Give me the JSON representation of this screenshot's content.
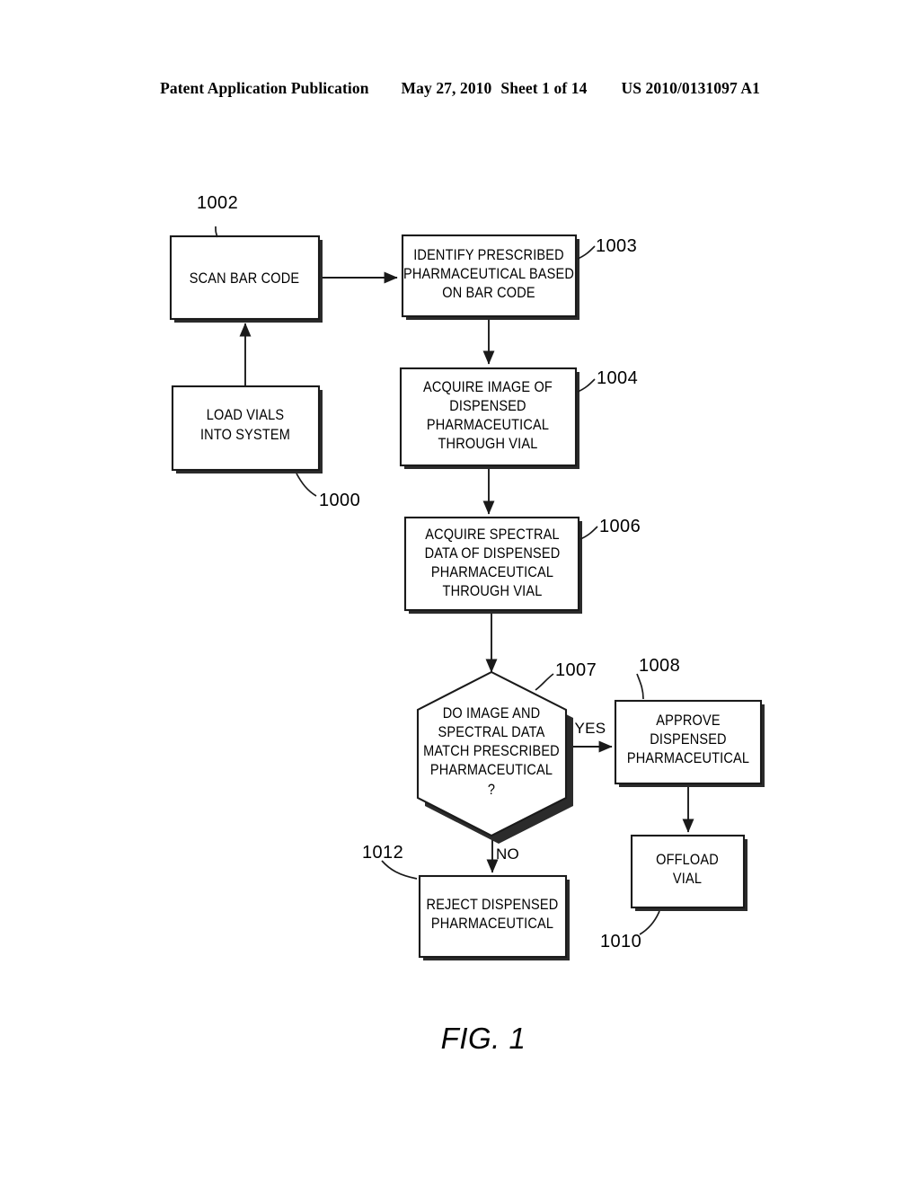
{
  "header": {
    "publication": "Patent Application Publication",
    "date": "May 27, 2010",
    "sheet": "Sheet 1 of 14",
    "patent_number": "US 2010/0131097 A1"
  },
  "figure": {
    "caption": "FIG. 1",
    "caption_label": "FIG.",
    "caption_number": "1"
  },
  "diagram_data": {
    "type": "flowchart",
    "title": "FIG. 1",
    "overall_reference": "1000",
    "nodes": [
      {
        "id": "scan_bar_code",
        "ref": "1002",
        "shape": "rect",
        "lines": [
          "SCAN BAR CODE"
        ],
        "text": "SCAN BAR CODE"
      },
      {
        "id": "identify_prescribed",
        "ref": "1003",
        "shape": "rect",
        "lines": [
          "IDENTIFY PRESCRIBED",
          "PHARMACEUTICAL BASED",
          "ON BAR CODE"
        ],
        "text": "IDENTIFY PRESCRIBED PHARMACEUTICAL BASED ON BAR CODE"
      },
      {
        "id": "load_vials",
        "ref": "1000",
        "shape": "rect",
        "lines": [
          "LOAD VIALS",
          "INTO SYSTEM"
        ],
        "text": "LOAD VIALS INTO SYSTEM"
      },
      {
        "id": "acquire_image",
        "ref": "1004",
        "shape": "rect",
        "lines": [
          "ACQUIRE IMAGE OF",
          "DISPENSED",
          "PHARMACEUTICAL",
          "THROUGH VIAL"
        ],
        "text": "ACQUIRE IMAGE OF DISPENSED PHARMACEUTICAL THROUGH VIAL"
      },
      {
        "id": "acquire_spectral",
        "ref": "1006",
        "shape": "rect",
        "lines": [
          "ACQUIRE SPECTRAL",
          "DATA OF DISPENSED",
          "PHARMACEUTICAL",
          "THROUGH VIAL"
        ],
        "text": "ACQUIRE SPECTRAL DATA OF DISPENSED PHARMACEUTICAL THROUGH VIAL"
      },
      {
        "id": "match_decision",
        "ref": "1007",
        "shape": "hexagon",
        "lines": [
          "DO IMAGE AND",
          "SPECTRAL DATA",
          "MATCH PRESCRIBED",
          "PHARMACEUTICAL",
          "?"
        ],
        "text": "DO IMAGE AND SPECTRAL DATA MATCH PRESCRIBED PHARMACEUTICAL ?"
      },
      {
        "id": "approve_dispensed",
        "ref": "1008",
        "shape": "rect",
        "lines": [
          "APPROVE",
          "DISPENSED",
          "PHARMACEUTICAL"
        ],
        "text": "APPROVE DISPENSED PHARMACEUTICAL"
      },
      {
        "id": "offload_vial",
        "ref": "1010",
        "shape": "rect",
        "lines": [
          "OFFLOAD",
          "VIAL"
        ],
        "text": "OFFLOAD VIAL"
      },
      {
        "id": "reject_dispensed",
        "ref": "1012",
        "shape": "rect",
        "lines": [
          "REJECT DISPENSED",
          "PHARMACEUTICAL"
        ],
        "text": "REJECT DISPENSED PHARMACEUTICAL"
      }
    ],
    "edges": [
      {
        "from": "load_vials",
        "to": "scan_bar_code",
        "label": ""
      },
      {
        "from": "scan_bar_code",
        "to": "identify_prescribed",
        "label": ""
      },
      {
        "from": "identify_prescribed",
        "to": "acquire_image",
        "label": ""
      },
      {
        "from": "acquire_image",
        "to": "acquire_spectral",
        "label": ""
      },
      {
        "from": "acquire_spectral",
        "to": "match_decision",
        "label": ""
      },
      {
        "from": "match_decision",
        "to": "approve_dispensed",
        "label": "YES"
      },
      {
        "from": "match_decision",
        "to": "reject_dispensed",
        "label": "NO"
      },
      {
        "from": "approve_dispensed",
        "to": "offload_vial",
        "label": ""
      }
    ],
    "edge_labels": {
      "yes": "YES",
      "no": "NO"
    },
    "reference_numerals": [
      "1000",
      "1002",
      "1003",
      "1004",
      "1006",
      "1007",
      "1008",
      "1010",
      "1012"
    ]
  }
}
